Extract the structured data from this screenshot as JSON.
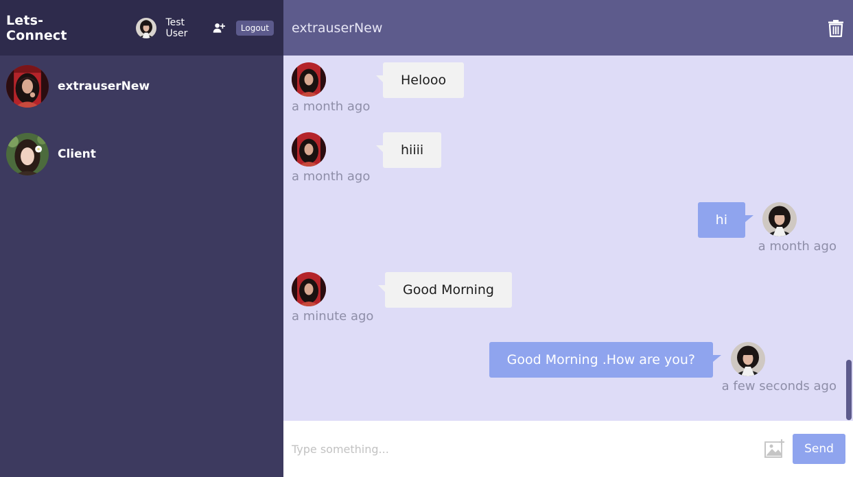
{
  "app": {
    "brand": "Lets-Connect"
  },
  "current_user": {
    "name": "Test User",
    "logout_label": "Logout"
  },
  "contacts": [
    {
      "name": "extrauserNew"
    },
    {
      "name": "Client"
    }
  ],
  "chat": {
    "title": "extrauserNew",
    "messages": [
      {
        "text": "Helooo",
        "time": "a month ago",
        "direction": "received"
      },
      {
        "text": "hiiii",
        "time": "a month ago",
        "direction": "received"
      },
      {
        "text": "hi",
        "time": "a month ago",
        "direction": "sent"
      },
      {
        "text": "Good Morning",
        "time": "a minute ago",
        "direction": "received"
      },
      {
        "text": "Good Morning .How are you?",
        "time": "a few seconds ago",
        "direction": "sent"
      }
    ],
    "input": {
      "placeholder": "Type something...",
      "value": ""
    },
    "send_label": "Send"
  },
  "icons": {
    "add_user": "add-user-icon",
    "trash": "trash-icon",
    "image": "image-icon"
  },
  "colors": {
    "sidebar_bg": "#3d3a5f",
    "sidebar_header_bg": "#2e2b4c",
    "chat_header_bg": "#5d5b8c",
    "chat_bg": "#dedcf7",
    "sent_bubble": "#8fa4ee",
    "received_bubble": "#f2f2f2"
  }
}
